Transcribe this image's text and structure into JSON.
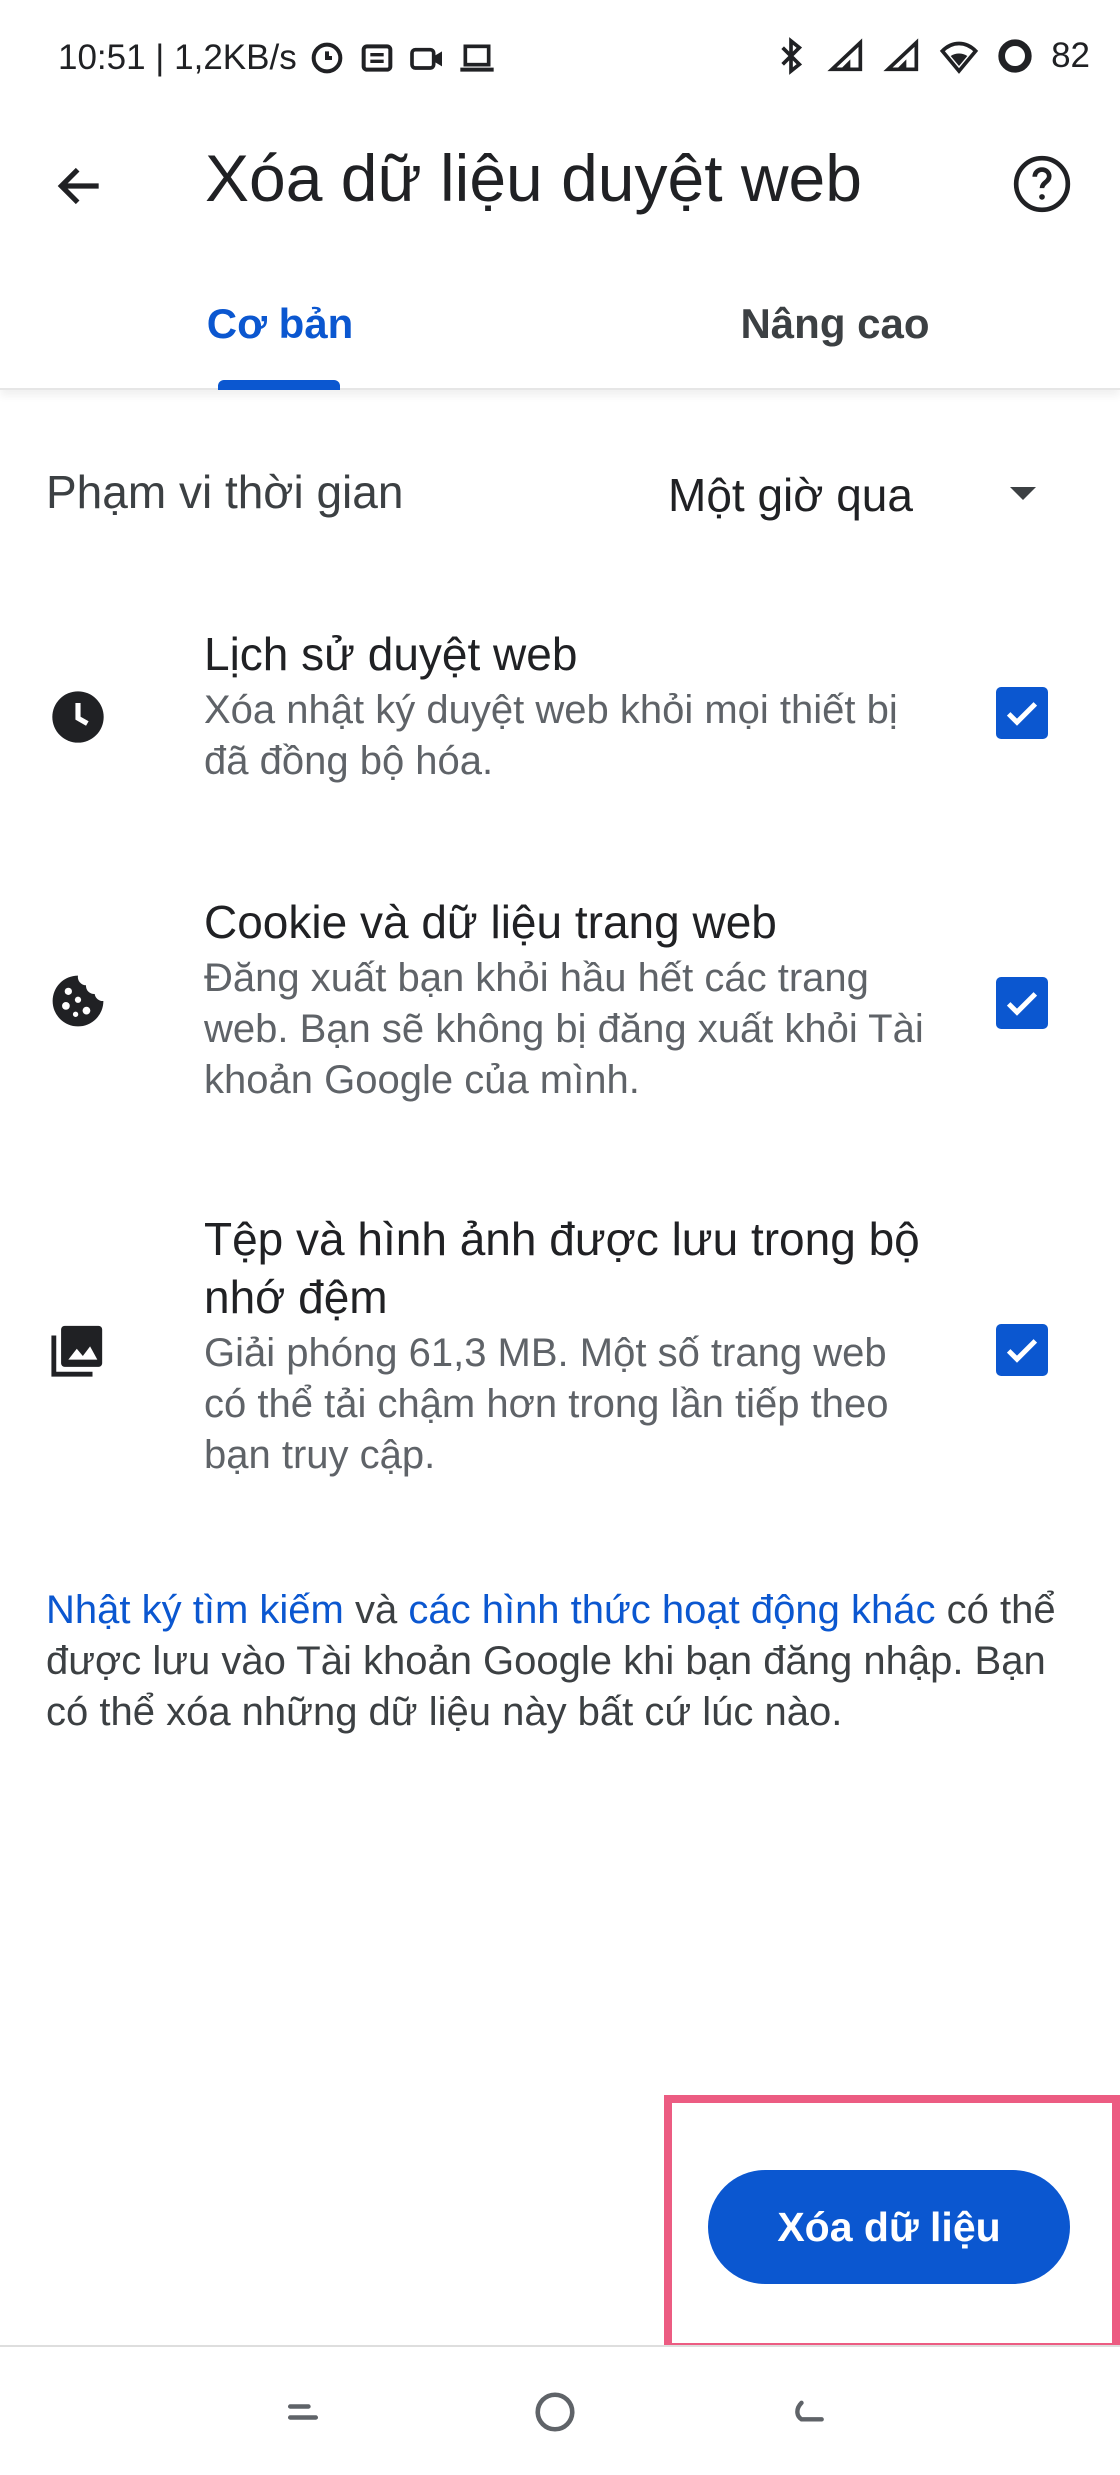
{
  "status_bar": {
    "time_speed": "10:51 | 1,2KB/s",
    "battery": "82"
  },
  "app_bar": {
    "title": "Xóa dữ liệu duyệt web",
    "back_icon": "arrow-back-icon",
    "help_icon": "help-circle-icon"
  },
  "tabs": [
    {
      "label": "Cơ bản",
      "selected": true
    },
    {
      "label": "Nâng cao",
      "selected": false
    }
  ],
  "time_range": {
    "label": "Phạm vi thời gian",
    "value": "Một giờ qua"
  },
  "options": [
    {
      "icon": "clock-icon",
      "title": "Lịch sử duyệt web",
      "description": "Xóa nhật ký duyệt web khỏi mọi thiết bị đã đồng bộ hóa.",
      "checked": true
    },
    {
      "icon": "cookie-icon",
      "title": "Cookie và dữ liệu trang web",
      "description": "Đăng xuất bạn khỏi hầu hết các trang web. Bạn sẽ không bị đăng xuất khỏi Tài khoản Google của mình.",
      "checked": true
    },
    {
      "icon": "image-stack-icon",
      "title": "Tệp và hình ảnh được lưu trong bộ nhớ đệm",
      "description": "Giải phóng 61,3 MB. Một số trang web có thể tải chậm hơn trong lần tiếp theo bạn truy cập.",
      "checked": true
    }
  ],
  "note": {
    "link1": "Nhật ký tìm kiếm",
    "connector": "và",
    "link2": "các hình thức hoạt động khác",
    "text": "có thể được lưu vào Tài khoản Google khi bạn đăng nhập. Bạn có thể xóa những dữ liệu này bất cứ lúc nào."
  },
  "action": {
    "clear_label": "Xóa dữ liệu"
  },
  "colors": {
    "accent": "#0b57d0",
    "highlight": "#ec5c82"
  }
}
